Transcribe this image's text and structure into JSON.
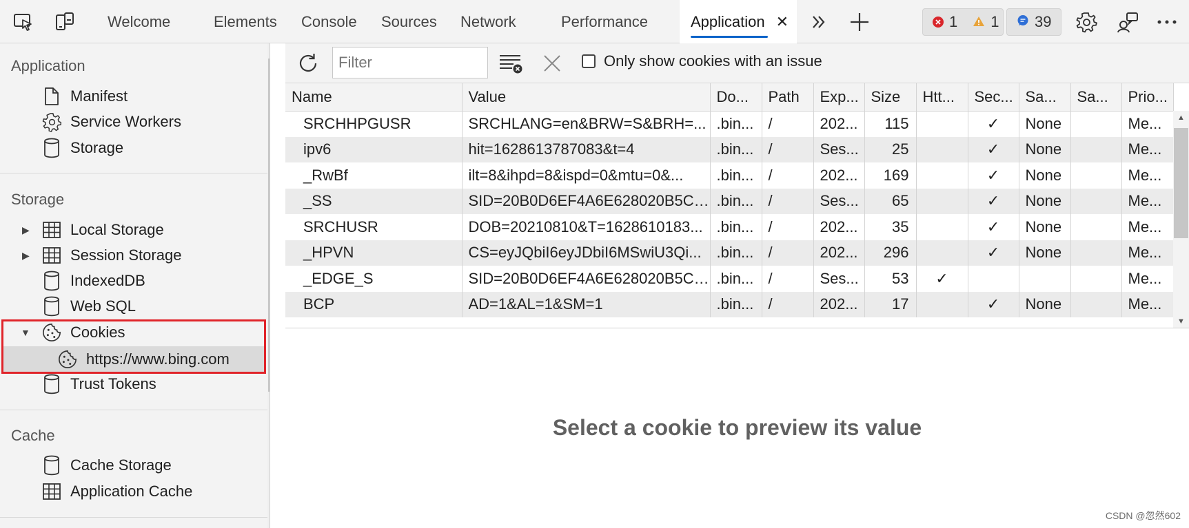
{
  "toolbar": {
    "tabs": [
      "Welcome",
      "Elements",
      "Console",
      "Sources",
      "Network",
      "Performance"
    ],
    "active_tab": "Application",
    "close_glyph": "✕",
    "more_glyph": "»",
    "add_glyph": "+",
    "errors_count": "1",
    "warnings_count": "1",
    "messages_count": "39",
    "icons": [
      "inspect-icon",
      "device-emulation-icon",
      "chevron-double-right-icon",
      "plus-icon",
      "settings-gear-icon",
      "feedback-icon",
      "more-icon"
    ]
  },
  "sidebar": {
    "sections": {
      "application": "Application",
      "storage": "Storage",
      "cache": "Cache"
    },
    "application_items": [
      {
        "label": "Manifest",
        "icon": "document-icon"
      },
      {
        "label": "Service Workers",
        "icon": "gear-icon"
      },
      {
        "label": "Storage",
        "icon": "database-icon"
      }
    ],
    "storage_items": [
      {
        "label": "Local Storage",
        "icon": "grid-icon",
        "expander": "collapsed"
      },
      {
        "label": "Session Storage",
        "icon": "grid-icon",
        "expander": "collapsed"
      },
      {
        "label": "IndexedDB",
        "icon": "database-icon"
      },
      {
        "label": "Web SQL",
        "icon": "database-icon"
      },
      {
        "label": "Cookies",
        "icon": "cookie-icon",
        "expander": "expanded"
      },
      {
        "label": "https://www.bing.com",
        "icon": "cookie-icon",
        "selected": true
      },
      {
        "label": "Trust Tokens",
        "icon": "database-icon"
      }
    ],
    "cache_items": [
      {
        "label": "Cache Storage",
        "icon": "database-icon"
      },
      {
        "label": "Application Cache",
        "icon": "grid-icon"
      }
    ]
  },
  "filterbar": {
    "filter_placeholder": "Filter",
    "only_issue_label": "Only show cookies with an issue",
    "only_issue_checked": false
  },
  "cookies": {
    "columns": [
      "Name",
      "Value",
      "Do...",
      "Path",
      "Exp...",
      "Size",
      "Htt...",
      "Sec...",
      "Sa...",
      "Sa...",
      "Prio..."
    ],
    "rows": [
      {
        "name": "SRCHHPGUSR",
        "value": "SRCHLANG=en&BRW=S&BRH=...",
        "domain": ".bin...",
        "path": "/",
        "expires": "202...",
        "size": "115",
        "httponly": "",
        "secure": "✓",
        "samesite": "None",
        "sameparty": "",
        "priority": "Me..."
      },
      {
        "name": "ipv6",
        "value": "hit=1628613787083&t=4",
        "domain": ".bin...",
        "path": "/",
        "expires": "Ses...",
        "size": "25",
        "httponly": "",
        "secure": "✓",
        "samesite": "None",
        "sameparty": "",
        "priority": "Me..."
      },
      {
        "name": "_RwBf",
        "value": "ilt=8&ihpd=8&ispd=0&mtu=0&...",
        "domain": ".bin...",
        "path": "/",
        "expires": "202...",
        "size": "169",
        "httponly": "",
        "secure": "✓",
        "samesite": "None",
        "sameparty": "",
        "priority": "Me..."
      },
      {
        "name": "_SS",
        "value": "SID=20B0D6EF4A6E628020B5C6...",
        "domain": ".bin...",
        "path": "/",
        "expires": "Ses...",
        "size": "65",
        "httponly": "",
        "secure": "✓",
        "samesite": "None",
        "sameparty": "",
        "priority": "Me..."
      },
      {
        "name": "SRCHUSR",
        "value": "DOB=20210810&T=1628610183...",
        "domain": ".bin...",
        "path": "/",
        "expires": "202...",
        "size": "35",
        "httponly": "",
        "secure": "✓",
        "samesite": "None",
        "sameparty": "",
        "priority": "Me..."
      },
      {
        "name": "_HPVN",
        "value": "CS=eyJQbiI6eyJDbiI6MSwiU3Qi...",
        "domain": ".bin...",
        "path": "/",
        "expires": "202...",
        "size": "296",
        "httponly": "",
        "secure": "✓",
        "samesite": "None",
        "sameparty": "",
        "priority": "Me..."
      },
      {
        "name": "_EDGE_S",
        "value": "SID=20B0D6EF4A6E628020B5C6...",
        "domain": ".bin...",
        "path": "/",
        "expires": "Ses...",
        "size": "53",
        "httponly": "✓",
        "secure": "",
        "samesite": "",
        "sameparty": "",
        "priority": "Me..."
      },
      {
        "name": "BCP",
        "value": "AD=1&AL=1&SM=1",
        "domain": ".bin...",
        "path": "/",
        "expires": "202...",
        "size": "17",
        "httponly": "",
        "secure": "✓",
        "samesite": "None",
        "sameparty": "",
        "priority": "Me..."
      }
    ]
  },
  "preview_message": "Select a cookie to preview its value",
  "watermark": "CSDN @忽然602",
  "colors": {
    "accent": "#0a63c9",
    "error": "#d9262b",
    "warning": "#e8a33a",
    "message": "#2f6fd6",
    "highlight_border": "#e0242a"
  }
}
